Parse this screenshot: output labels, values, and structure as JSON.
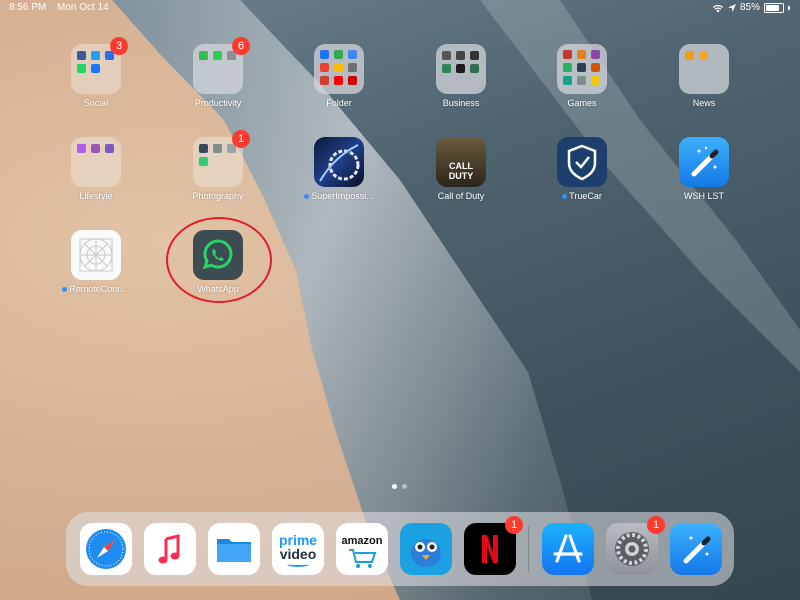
{
  "status_bar": {
    "time": "8:56 PM",
    "date": "Mon Oct 14",
    "battery": "85%",
    "battery_level": 0.85
  },
  "apps": [
    {
      "id": "social",
      "label": "Social",
      "badge": "3"
    },
    {
      "id": "productivity",
      "label": "Productivity",
      "badge": "6"
    },
    {
      "id": "folder",
      "label": "Folder",
      "badge": ""
    },
    {
      "id": "business",
      "label": "Business",
      "badge": ""
    },
    {
      "id": "games",
      "label": "Games",
      "badge": ""
    },
    {
      "id": "news",
      "label": "News",
      "badge": ""
    },
    {
      "id": "lifestyle",
      "label": "Lifestyle",
      "badge": ""
    },
    {
      "id": "photography",
      "label": "Photography",
      "badge": "1"
    },
    {
      "id": "superimpose",
      "label": "SuperImpossi...",
      "badge": ""
    },
    {
      "id": "callofduty",
      "label": "Call of Duty",
      "badge": ""
    },
    {
      "id": "truecar",
      "label": "TrueCar",
      "badge": ""
    },
    {
      "id": "wshlst",
      "label": "WSH LST",
      "badge": ""
    },
    {
      "id": "remoteconn",
      "label": "RemoteConn...",
      "badge": ""
    },
    {
      "id": "whatsapp",
      "label": "WhatsApp",
      "badge": ""
    }
  ],
  "icon_art": {
    "cod_top": "CALL",
    "cod_bottom": "DUTY",
    "prime_line1": "prime",
    "prime_line2": "video",
    "amazon": "amazon"
  },
  "dock": [
    {
      "id": "safari",
      "name": "safari-icon",
      "badge": ""
    },
    {
      "id": "music",
      "name": "music-icon",
      "badge": ""
    },
    {
      "id": "files",
      "name": "files-icon",
      "badge": ""
    },
    {
      "id": "primevideo",
      "name": "prime-video-icon",
      "badge": ""
    },
    {
      "id": "amazon",
      "name": "amazon-icon",
      "badge": ""
    },
    {
      "id": "tweetbot",
      "name": "tweetbot-icon",
      "badge": ""
    },
    {
      "id": "netflix",
      "name": "netflix-icon",
      "badge": "1"
    },
    {
      "id": "appstore",
      "name": "app-store-icon",
      "badge": ""
    },
    {
      "id": "settings",
      "name": "settings-icon",
      "badge": "1"
    },
    {
      "id": "wshlst_dock",
      "name": "wsh-lst-icon",
      "badge": ""
    }
  ],
  "colors": {
    "badge": "#ff3b30",
    "highlight": "#e21e26",
    "whatsapp": "#25d366",
    "netflix": "#e50914"
  }
}
